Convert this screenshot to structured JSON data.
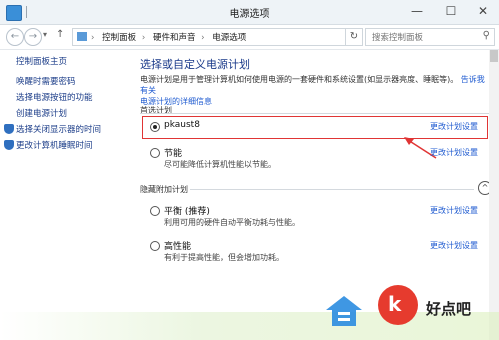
{
  "window": {
    "title": "电源选项",
    "min_glyph": "—",
    "max_glyph": "☐",
    "close_glyph": "✕"
  },
  "address": {
    "back_glyph": "←",
    "forward_glyph": "→",
    "recent_glyph": "▾",
    "up_glyph": "↑",
    "breadcrumbs": [
      "控制面板",
      "硬件和声音",
      "电源选项"
    ],
    "separator": "›",
    "refresh_glyph": "↻",
    "search_placeholder": "搜索控制面板",
    "search_glyph": "⚲"
  },
  "sidebar": {
    "home": "控制面板主页",
    "items": [
      {
        "label": "唤醒时需要密码",
        "icon": null
      },
      {
        "label": "选择电源按钮的功能",
        "icon": null
      },
      {
        "label": "创建电源计划",
        "icon": null
      },
      {
        "label": "选择关闭显示器的时间",
        "icon": "shield-icon"
      },
      {
        "label": "更改计算机睡眠时间",
        "icon": "shield-icon"
      }
    ]
  },
  "main": {
    "heading": "选择或自定义电源计划",
    "desc_line1": "电源计划是用于管理计算机如何使用电源的一套硬件和系统设置(如显示器亮度、睡眠等)。",
    "desc_link1": "告诉我有关",
    "desc_link2": "电源计划的详细信息",
    "preferred_label": "首选计划",
    "hidden_label": "隐藏附加计划",
    "collapse_glyph": "^",
    "change_label": "更改计划设置",
    "plans": [
      {
        "name": "pkaust8",
        "desc": "",
        "selected": true
      },
      {
        "name": "节能",
        "desc": "尽可能降低计算机性能以节能。",
        "selected": false
      },
      {
        "name": "平衡 (推荐)",
        "desc": "利用可用的硬件自动平衡功耗与性能。",
        "selected": false
      },
      {
        "name": "高性能",
        "desc": "有利于提高性能，但会增加功耗。",
        "selected": false
      }
    ]
  },
  "watermark": {
    "text": "好点吧",
    "logo_letter": "k"
  },
  "colors": {
    "link": "#1e5ad0",
    "heading": "#1a3a8a",
    "highlight_border": "#e03535",
    "arrow": "#e03535"
  }
}
